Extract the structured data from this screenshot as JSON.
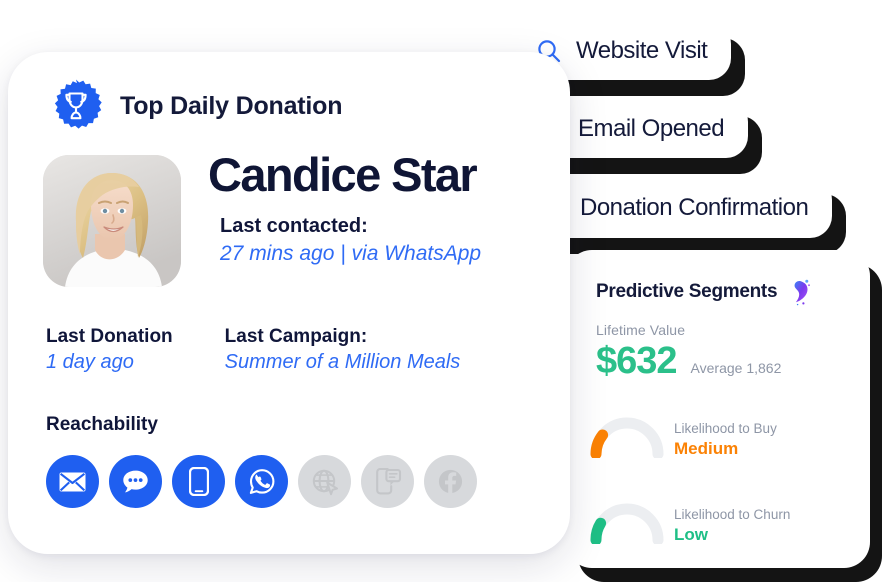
{
  "profile_card": {
    "badge": {
      "icon": "trophy-badge-icon",
      "title": "Top Daily Donation"
    },
    "avatar": {
      "icon": "avatar-photo",
      "alt": "Candice Star"
    },
    "person_name": "Candice Star",
    "last_contacted": {
      "label": "Last contacted:",
      "value": "27 mins ago | via WhatsApp"
    },
    "last_donation": {
      "label": "Last Donation",
      "value": "1 day ago"
    },
    "last_campaign": {
      "label": "Last Campaign:",
      "value": "Summer of a Million Meals"
    },
    "reachability": {
      "title": "Reachability",
      "channels": [
        {
          "name": "email",
          "icon": "envelope-icon",
          "enabled": true
        },
        {
          "name": "sms",
          "icon": "chat-bubble-icon",
          "enabled": true
        },
        {
          "name": "mobile-push",
          "icon": "mobile-phone-icon",
          "enabled": true
        },
        {
          "name": "whatsapp",
          "icon": "whatsapp-icon",
          "enabled": true
        },
        {
          "name": "web-push",
          "icon": "globe-cursor-icon",
          "enabled": false
        },
        {
          "name": "in-app",
          "icon": "phone-message-icon",
          "enabled": false
        },
        {
          "name": "facebook",
          "icon": "facebook-icon",
          "enabled": false
        }
      ]
    }
  },
  "event_pills": [
    {
      "name": "website-visit",
      "icon": "search-icon",
      "label": "Website Visit"
    },
    {
      "name": "email-opened",
      "icon": "envelope-outline-icon",
      "label": "Email Opened"
    },
    {
      "name": "donation-confirmation",
      "icon": "banknote-icon",
      "label": "Donation Confirmation"
    }
  ],
  "segments_card": {
    "title": "Predictive Segments",
    "brand_icon": "brand-spark-icon",
    "lifetime_value": {
      "label": "Lifetime Value",
      "value": "$632",
      "average": "Average 1,862"
    },
    "gauges": [
      {
        "name": "likelihood-to-buy",
        "label": "Likelihood to Buy",
        "value": "Medium",
        "color": "#fb8205",
        "fill_pct": 24
      },
      {
        "name": "likelihood-to-churn",
        "label": "Likelihood to Churn",
        "value": "Low",
        "color": "#1fbf86",
        "fill_pct": 20
      }
    ]
  },
  "colors": {
    "brand_blue": "#1f5ff0",
    "link_blue": "#2f6bf5",
    "ink": "#141a3a",
    "muted": "#8e96a6",
    "green": "#2bc08a",
    "orange": "#fb8205",
    "disabled_gray": "#d7d9dc"
  }
}
